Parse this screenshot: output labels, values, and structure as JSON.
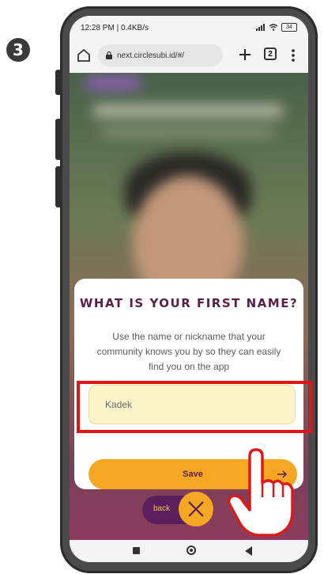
{
  "step": {
    "number": "3"
  },
  "status_bar": {
    "left": "12:28 PM | 0.4KB/s",
    "battery": "34"
  },
  "browser": {
    "url": "next.circlesubi.id/#/",
    "tab_count": "2"
  },
  "modal": {
    "title": "WHAT IS YOUR FIRST NAME?",
    "description": "Use the name or nickname that your community knows you by so they can easily find you on the app",
    "name_input_value": "Kadek",
    "save_label": "Save"
  },
  "bottom": {
    "back_label": "back"
  },
  "colors": {
    "accent": "#f5a623",
    "title": "#5a1f44",
    "input_bg": "#fdf3c8",
    "highlight": "#e01616"
  },
  "icons": [
    "home-icon",
    "lock-icon",
    "plus-icon",
    "tabs-icon",
    "menu-icon",
    "arrow-right-icon",
    "close-icon",
    "pointer-hand-icon"
  ]
}
